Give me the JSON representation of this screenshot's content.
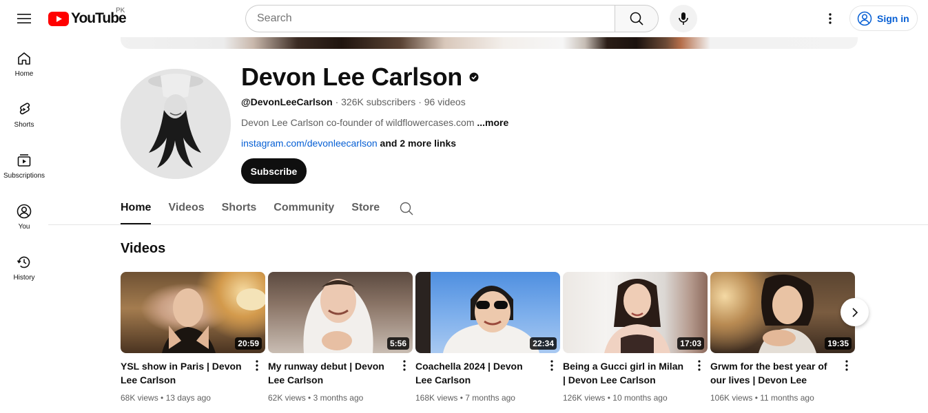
{
  "header": {
    "logo_text": "YouTube",
    "region": "PK",
    "search_placeholder": "Search",
    "signin_label": "Sign in"
  },
  "sidebar": {
    "items": [
      {
        "label": "Home",
        "icon": "home-icon"
      },
      {
        "label": "Shorts",
        "icon": "shorts-icon"
      },
      {
        "label": "Subscriptions",
        "icon": "subscriptions-icon"
      },
      {
        "label": "You",
        "icon": "you-icon"
      },
      {
        "label": "History",
        "icon": "history-icon"
      }
    ]
  },
  "channel": {
    "name": "Devon Lee Carlson",
    "handle": "@DevonLeeCarlson",
    "subscribers": "326K subscribers",
    "videos_count": "96 videos",
    "description": "Devon Lee Carlson co-founder of wildflowercases.com",
    "more_label": "...more",
    "link": "instagram.com/devonleecarlson",
    "more_links": "and 2 more links",
    "subscribe_label": "Subscribe"
  },
  "tabs": [
    {
      "label": "Home",
      "active": true
    },
    {
      "label": "Videos",
      "active": false
    },
    {
      "label": "Shorts",
      "active": false
    },
    {
      "label": "Community",
      "active": false
    },
    {
      "label": "Store",
      "active": false
    }
  ],
  "videos_section": {
    "title": "Videos",
    "items": [
      {
        "title": "YSL show in Paris | Devon Lee Carlson",
        "duration": "20:59",
        "views": "68K views",
        "age": "13 days ago"
      },
      {
        "title": "My runway debut | Devon Lee Carlson",
        "duration": "5:56",
        "views": "62K views",
        "age": "3 months ago"
      },
      {
        "title": "Coachella 2024 | Devon Lee Carlson",
        "duration": "22:34",
        "views": "168K views",
        "age": "7 months ago"
      },
      {
        "title": "Being a Gucci girl in Milan | Devon Lee Carlson",
        "duration": "17:03",
        "views": "126K views",
        "age": "10 months ago"
      },
      {
        "title": "Grwm for the best year of our lives | Devon Lee Carlson",
        "duration": "19:35",
        "views": "106K views",
        "age": "11 months ago"
      }
    ]
  },
  "colors": {
    "brand_red": "#ff0000",
    "link_blue": "#065fd4",
    "text_primary": "#0f0f0f",
    "text_secondary": "#606060"
  }
}
